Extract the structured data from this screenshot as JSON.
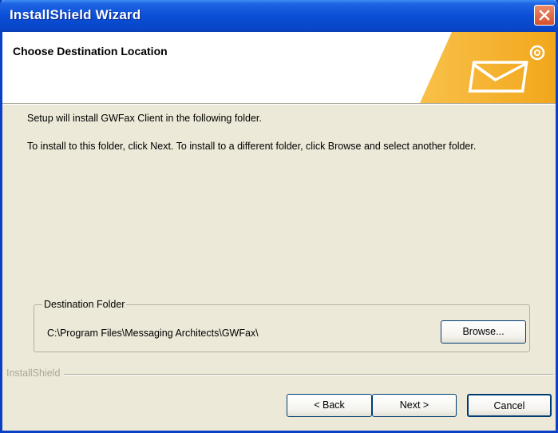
{
  "window": {
    "title": "InstallShield Wizard"
  },
  "header": {
    "title": "Choose Destination Location"
  },
  "content": {
    "line1": "Setup will install GWFax Client in the following folder.",
    "line2": "To install to this folder, click Next. To install to a different folder, click Browse and select another folder."
  },
  "destination": {
    "legend": "Destination Folder",
    "path": "C:\\Program Files\\Messaging Architects\\GWFax\\",
    "browse_label": "Browse..."
  },
  "footer": {
    "brand": "InstallShield",
    "back_label": "< Back",
    "next_label": "Next >",
    "cancel_label": "Cancel"
  },
  "colors": {
    "titlebar": "#0a4fd6",
    "close": "#d5502a",
    "header_accent": "#f6b52c",
    "window_bg": "#ece9d8"
  },
  "icons": {
    "close": "close-icon",
    "header": "mail-icon"
  }
}
